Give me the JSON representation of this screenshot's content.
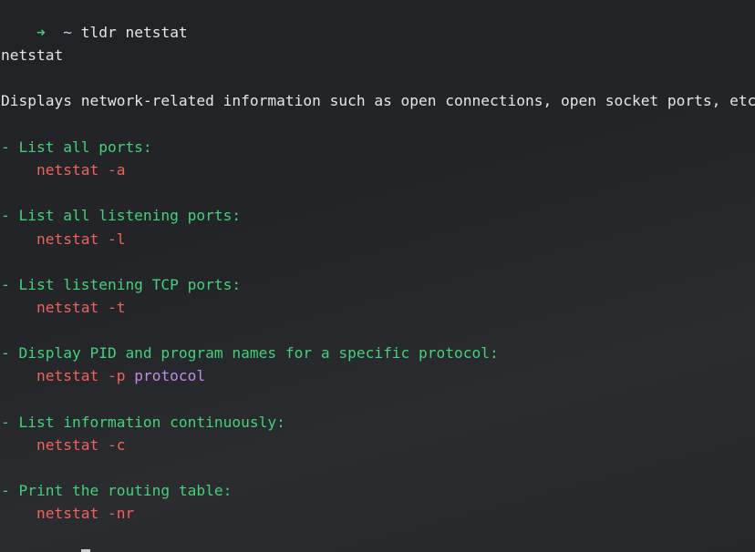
{
  "terminal": {
    "prompt_arrow": "➜",
    "prompt_dir": "~",
    "command": "tldr netstat",
    "page_name": "netstat",
    "description": "Displays network-related information such as open connections, open socket ports, etc.",
    "examples": [
      {
        "desc": "- List all ports:",
        "cmd": "netstat -a",
        "param": ""
      },
      {
        "desc": "- List all listening ports:",
        "cmd": "netstat -l",
        "param": ""
      },
      {
        "desc": "- List listening TCP ports:",
        "cmd": "netstat -t",
        "param": ""
      },
      {
        "desc": "- Display PID and program names for a specific protocol:",
        "cmd": "netstat -p",
        "param": "protocol"
      },
      {
        "desc": "- List information continuously:",
        "cmd": "netstat -c",
        "param": ""
      },
      {
        "desc": "- Print the routing table:",
        "cmd": "netstat -nr",
        "param": ""
      }
    ],
    "colors": {
      "background": "#232529",
      "prompt_arrow": "#43d17a",
      "description_green": "#43d17a",
      "command_red": "#f0625a",
      "param_purple": "#c18ae6",
      "text": "#e6e6e6"
    }
  }
}
